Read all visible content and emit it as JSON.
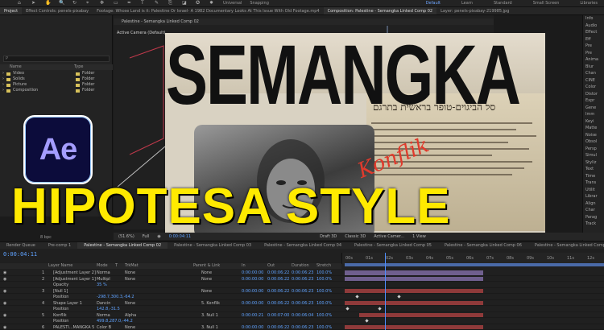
{
  "toolbar": {
    "options": [
      "Universal",
      "Snapping"
    ],
    "workspaces": [
      "Default",
      "Learn",
      "Standard",
      "Small Screen",
      "Libraries"
    ]
  },
  "panel_tabs": {
    "project": "Project",
    "effect_controls": "Effect Controls: penels-pixabay",
    "footage": "Footage: Whose Land is it: Palestine Or Israel- A 1982 Documentary Looks At This Issue With Old Footage.mp4",
    "composition": "Composition: Palestine - Semangka Linked Comp 02",
    "layer": "Layer: penels-pixabay-219985.jpg"
  },
  "project_panel": {
    "search_placeholder": "P",
    "col_name": "Name",
    "col_type": "Type",
    "items": [
      {
        "name": "Video",
        "type": "Folder"
      },
      {
        "name": "Solids",
        "type": "Folder"
      },
      {
        "name": "Picture",
        "type": "Folder"
      },
      {
        "name": "Composition",
        "type": "Folder"
      }
    ],
    "footer_bits": "8 bpc"
  },
  "viewer": {
    "comp_tab": "Palestine - Semangka Linked Comp 02",
    "camera_label": "Active Camera (Default)",
    "zoom": "(51.6%)",
    "quality": "Full",
    "timecode": "0:00:04:11",
    "renderer": "Classic 3D",
    "draft": "Draft 3D",
    "camera": "Active Camer...",
    "views": "1 View"
  },
  "artwork": {
    "headline": "SEMANGKA",
    "overlay_title": "HIPOTESA STYLE",
    "logo_text": "Ae",
    "script_word": "Konflik",
    "news_header": "סל הביגוים-טופר   בראשית בתרגם"
  },
  "right_panel": {
    "items": [
      "Info",
      "Audio",
      "Effect",
      "Eff",
      "Pre",
      "Pre",
      "Anima",
      "Blur",
      "Chan",
      "CINE",
      "Color",
      "Distor",
      "Expr",
      "Gene",
      "Imm",
      "Keyi",
      "Matte",
      "Noise",
      "Obsol",
      "Persp",
      "Simul",
      "Styliz",
      "Text",
      "Time",
      "Trans",
      "Utilit",
      "Librar",
      "Align",
      "Char",
      "Parag",
      "Track"
    ]
  },
  "timeline": {
    "tabs": [
      "Render Queue",
      "Pre-comp 1",
      "Palestine - Semangka Linked Comp 02",
      "Palestine - Semangka Linked Comp 03",
      "Palestine - Semangka Linked Comp 04",
      "Palestine - Semangka Linked Comp 05",
      "Palestine - Semangka Linked Comp 06",
      "Palestine - Semangka Linked Comp 07"
    ],
    "current_time": "0:00:04:11",
    "columns": {
      "name": "Layer Name",
      "mode": "Mode",
      "t": "T",
      "trkmat": "TrkMat",
      "parent": "Parent & Link",
      "in": "In",
      "out": "Out",
      "duration": "Duration",
      "stretch": "Stretch"
    },
    "layers": [
      {
        "num": "1",
        "name": "[Adjustment Layer 2]",
        "mode": "Norma",
        "trkmat": "None",
        "parent": "None",
        "in": "0:00:00:00",
        "out": "0:00:06:22",
        "duration": "0:00:06:23",
        "stretch": "100.0%"
      },
      {
        "num": "2",
        "name": "[Adjustment Layer 1]",
        "mode": "Multipl",
        "trkmat": "None",
        "parent": "None",
        "in": "0:00:00:00",
        "out": "0:00:06:22",
        "duration": "0:00:06:23",
        "stretch": "100.0%"
      },
      {
        "num": "",
        "name": "Opacity",
        "mode": "35 %",
        "trkmat": "",
        "parent": "",
        "in": "",
        "out": "",
        "duration": "",
        "stretch": ""
      },
      {
        "num": "3",
        "name": "[Null 1]",
        "mode": "",
        "trkmat": "",
        "parent": "None",
        "in": "0:00:00:00",
        "out": "0:00:06:22",
        "duration": "0:00:06:23",
        "stretch": "100.0%"
      },
      {
        "num": "",
        "name": "Position",
        "mode": "-298.7,300.3,-64.2",
        "trkmat": "",
        "parent": "",
        "in": "",
        "out": "",
        "duration": "",
        "stretch": ""
      },
      {
        "num": "4",
        "name": "Shape Layer 1",
        "mode": "Dancin",
        "trkmat": "None",
        "parent": "5. Konflik",
        "in": "0:00:00:00",
        "out": "0:00:06:22",
        "duration": "0:00:06:23",
        "stretch": "100.0%"
      },
      {
        "num": "",
        "name": "Position",
        "mode": "142.8,-31.5",
        "trkmat": "",
        "parent": "",
        "in": "",
        "out": "",
        "duration": "",
        "stretch": ""
      },
      {
        "num": "5",
        "name": "Konflik",
        "mode": "Norma",
        "trkmat": "Alpha",
        "parent": "3. Null 1",
        "in": "0:00:00:21",
        "out": "0:00:07:00",
        "duration": "0:00:06:04",
        "stretch": "100.0%"
      },
      {
        "num": "",
        "name": "Position",
        "mode": "499.8,287.0,-44.2",
        "trkmat": "",
        "parent": "",
        "in": "",
        "out": "",
        "duration": "",
        "stretch": ""
      },
      {
        "num": "6",
        "name": "PALESTI...MANGKA 5",
        "mode": "Color B",
        "trkmat": "None",
        "parent": "3. Null 1",
        "in": "0:00:00:00",
        "out": "0:00:06:22",
        "duration": "0:00:06:23",
        "stretch": "100.0%"
      }
    ],
    "ruler": [
      "00s",
      "01s",
      "02s",
      "03s",
      "04s",
      "05s",
      "06s",
      "07s",
      "08s",
      "09s",
      "10s",
      "11s",
      "12s"
    ]
  },
  "colors": {
    "accent_blue": "#5fa2ff",
    "title_yellow": "#ffea00",
    "folder_yellow": "#d7c15a",
    "clip_red": "#8f3a3a",
    "clip_purple": "#6f5f8e"
  }
}
